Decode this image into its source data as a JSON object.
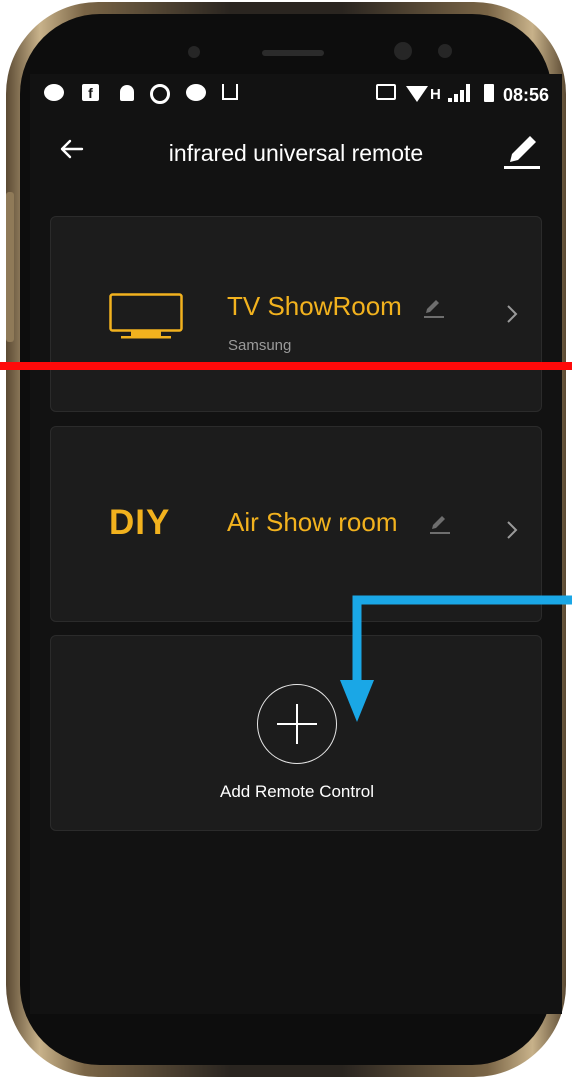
{
  "status_bar": {
    "left_icons": [
      "line-icon",
      "facebook-icon",
      "bell-icon",
      "aperture-icon",
      "line-icon",
      "share-icon"
    ],
    "right_icons": [
      "cast-icon",
      "wifi-icon",
      "signal-icon",
      "battery-icon"
    ],
    "network_label": "H",
    "time": "08:56"
  },
  "app_bar": {
    "back_icon": "arrow-left-icon",
    "title": "infrared universal remote",
    "edit_icon": "pencil-icon"
  },
  "remotes": [
    {
      "icon": "tv-icon",
      "name": "TV ShowRoom",
      "brand": "Samsung"
    },
    {
      "icon_text": "DIY",
      "name": "Air Show room"
    }
  ],
  "add_remote": {
    "label": "Add Remote Control"
  },
  "colors": {
    "accent": "#f2b21e",
    "background": "#121212",
    "card": "#1c1c1c",
    "annotation_red": "#ff0a0a",
    "annotation_blue": "#1aa7e6"
  }
}
